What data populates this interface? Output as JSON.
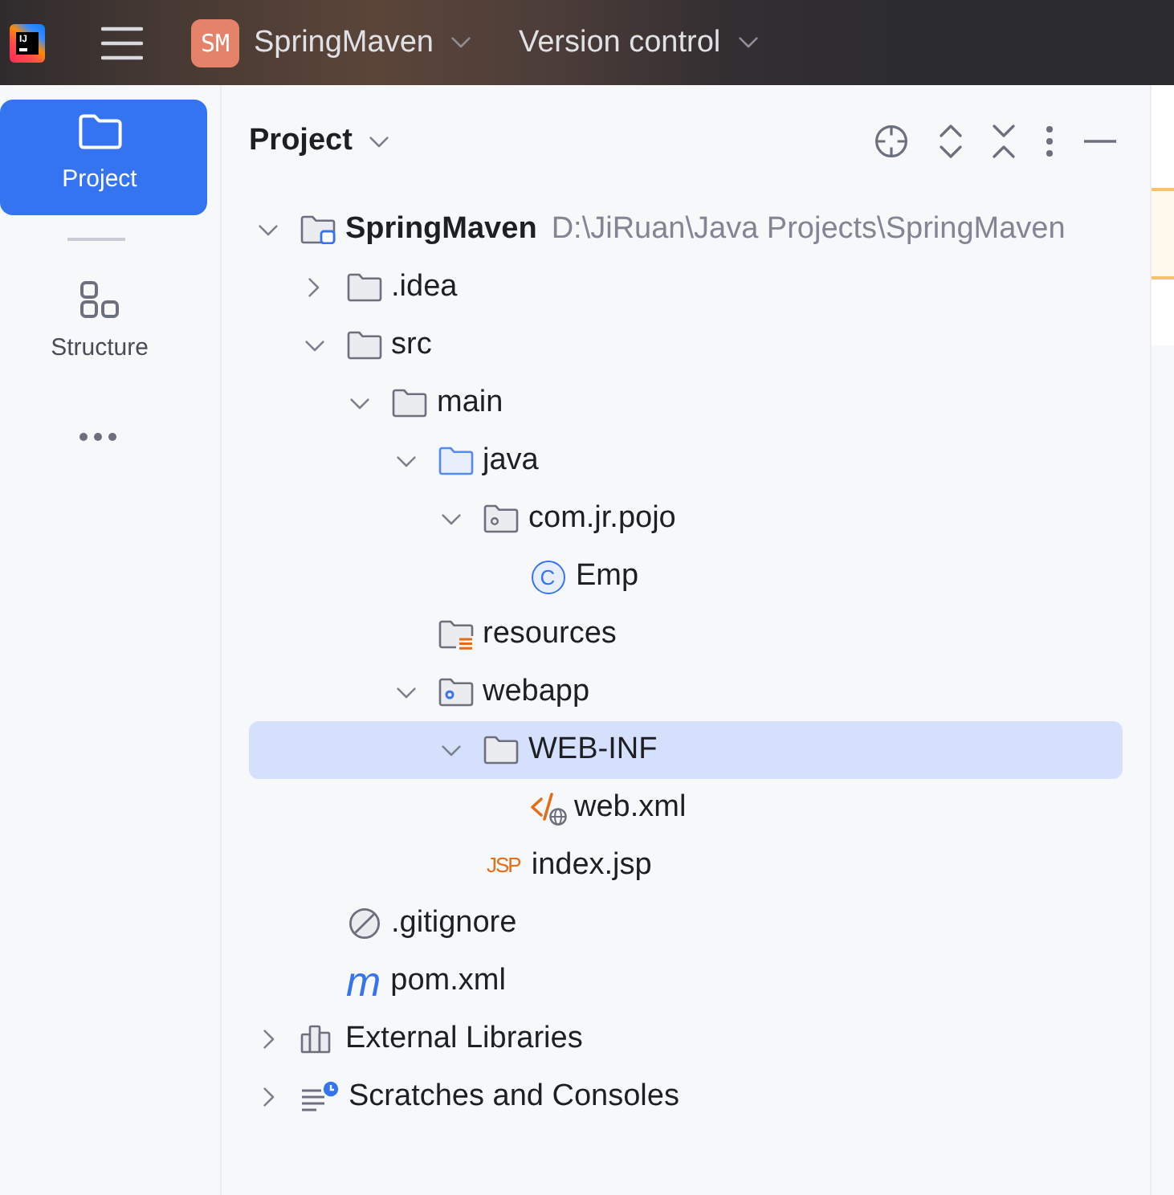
{
  "title_bar": {
    "logo_text": "IJ",
    "project_initials": "SM",
    "project_name": "SpringMaven",
    "vcs_menu": "Version control"
  },
  "sidebar": {
    "items": [
      {
        "kind": "project",
        "label": "Project",
        "selected": true
      },
      {
        "kind": "structure",
        "label": "Structure",
        "selected": false
      }
    ]
  },
  "project_panel": {
    "title": "Project",
    "tree": [
      {
        "kind": "module",
        "label": "SpringMaven",
        "path": "D:\\JiRuan\\Java Projects\\SpringMaven",
        "expanded": true,
        "selected": false,
        "children": [
          {
            "kind": "folder",
            "label": ".idea",
            "expanded": false,
            "selected": false
          },
          {
            "kind": "folder",
            "label": "src",
            "expanded": true,
            "selected": false,
            "children": [
              {
                "kind": "folder",
                "label": "main",
                "expanded": true,
                "selected": false,
                "children": [
                  {
                    "kind": "source",
                    "label": "java",
                    "expanded": true,
                    "selected": false,
                    "children": [
                      {
                        "kind": "package",
                        "label": "com.jr.pojo",
                        "expanded": true,
                        "selected": false,
                        "children": [
                          {
                            "kind": "class",
                            "label": "Emp",
                            "icon_text": "C",
                            "selected": false
                          }
                        ]
                      }
                    ]
                  },
                  {
                    "kind": "resources",
                    "label": "resources",
                    "selected": false
                  },
                  {
                    "kind": "web",
                    "label": "webapp",
                    "expanded": true,
                    "selected": false,
                    "children": [
                      {
                        "kind": "folder",
                        "label": "WEB-INF",
                        "expanded": true,
                        "selected": true,
                        "children": [
                          {
                            "kind": "xml",
                            "label": "web.xml",
                            "selected": false
                          }
                        ]
                      },
                      {
                        "kind": "jsp",
                        "label": "index.jsp",
                        "icon_text": "JSP",
                        "selected": false
                      }
                    ]
                  }
                ]
              }
            ]
          },
          {
            "kind": "ignore",
            "label": ".gitignore",
            "selected": false
          },
          {
            "kind": "maven",
            "label": "pom.xml",
            "icon_text": "m",
            "selected": false
          }
        ]
      },
      {
        "kind": "libraries",
        "label": "External Libraries",
        "expanded": false,
        "selected": false
      },
      {
        "kind": "scratches",
        "label": "Scratches and Consoles",
        "expanded": false,
        "selected": false
      }
    ]
  }
}
